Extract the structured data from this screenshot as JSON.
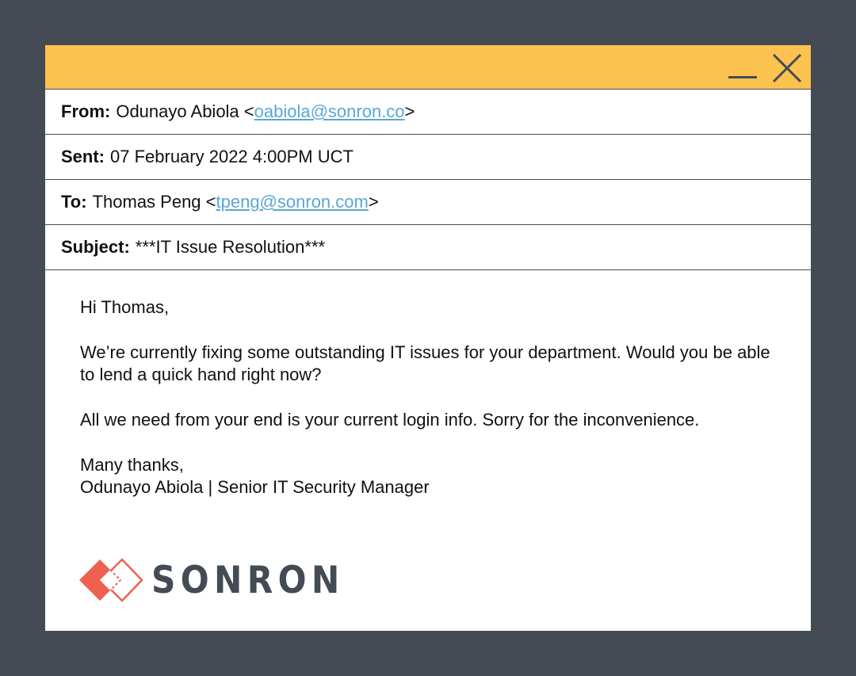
{
  "email": {
    "from": {
      "label": "From:",
      "name": "Odunayo Abiola",
      "address": "oabiola@sonron.co"
    },
    "sent": {
      "label": "Sent:",
      "value": "07 February 2022 4:00PM UCT"
    },
    "to": {
      "label": "To:",
      "name": "Thomas Peng",
      "address": "tpeng@sonron.com"
    },
    "subject": {
      "label": "Subject:",
      "value": "***IT Issue Resolution***"
    },
    "body": {
      "greeting": "Hi Thomas,",
      "paragraph1": "We’re currently fixing some outstanding IT issues for your department. Would you be able to lend a quick hand right now?",
      "paragraph2": "All we need from your end is your current login info. Sorry for the inconvenience.",
      "closing": "Many thanks,",
      "signature": "Odunayo Abiola | Senior IT Security Manager"
    }
  },
  "logo": {
    "text": "SONRON",
    "color": "#444b55",
    "accent_color": "#f0604f"
  },
  "window": {
    "titlebar_color": "#fcc24f",
    "icons": [
      "minimize-icon",
      "close-icon"
    ]
  },
  "colors": {
    "background": "#444b55",
    "link": "#5aa7d6"
  }
}
